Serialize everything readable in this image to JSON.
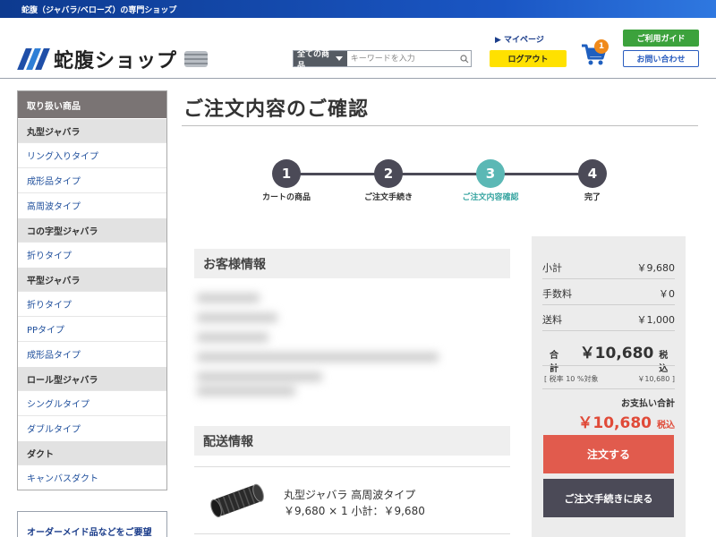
{
  "topbar": {
    "text": "蛇腹（ジャバラ/ベローズ）の専門ショップ"
  },
  "header": {
    "logo_text": "蛇腹ショップ",
    "search": {
      "category": "全ての商品",
      "placeholder": "キーワードを入力"
    },
    "mypage": "▶ マイページ",
    "logout": "ログアウト",
    "cart_count": "1",
    "guide": "ご利用ガイド",
    "contact": "お問い合わせ"
  },
  "sidebar": {
    "title": "取り扱い商品",
    "groups": [
      {
        "label": "丸型ジャバラ",
        "items": [
          "リング入りタイプ",
          "成形品タイプ",
          "高周波タイプ"
        ]
      },
      {
        "label": "コの字型ジャバラ",
        "items": [
          "折りタイプ"
        ]
      },
      {
        "label": "平型ジャバラ",
        "items": [
          "折りタイプ",
          "PPタイプ",
          "成形品タイプ"
        ]
      },
      {
        "label": "ロール型ジャバラ",
        "items": [
          "シングルタイプ",
          "ダブルタイプ"
        ]
      },
      {
        "label": "ダクト",
        "items": [
          "キャンバスダクト"
        ]
      }
    ],
    "cta": "オーダーメイド品などをご要望"
  },
  "main": {
    "title": "ご注文内容のご確認",
    "steps": [
      {
        "num": "1",
        "label": "カートの商品"
      },
      {
        "num": "2",
        "label": "ご注文手続き"
      },
      {
        "num": "3",
        "label": "ご注文内容確認"
      },
      {
        "num": "4",
        "label": "完了"
      }
    ],
    "active_step": 3,
    "customer_heading": "お客様情報",
    "shipping_heading": "配送情報",
    "item": {
      "name": "丸型ジャバラ 高周波タイプ",
      "price_line": "￥9,680 × 1  小計：￥9,680"
    }
  },
  "summary": {
    "subtotal_label": "小計",
    "subtotal": "￥9,680",
    "fee_label": "手数料",
    "fee": "￥0",
    "shipping_label": "送料",
    "shipping": "￥1,000",
    "total_label": "合計",
    "total": "￥10,680",
    "tax_incl": "税込",
    "tax_note_label": "[ 税率 10 %対象",
    "tax_note_value": "￥10,680 ]",
    "pay_label": "お支払い合計",
    "pay_total": "￥10,680",
    "pay_tax_incl": "税込",
    "order_button": "注文する",
    "back_button": "ご注文手続きに戻る"
  },
  "colors": {
    "brand_blue": "#1f4fa8",
    "accent_teal": "#5bb8b5",
    "order_red": "#e15b4d",
    "dark_button": "#4b4a57",
    "guide_green": "#3ca23c",
    "logout_yellow": "#ffe100"
  }
}
